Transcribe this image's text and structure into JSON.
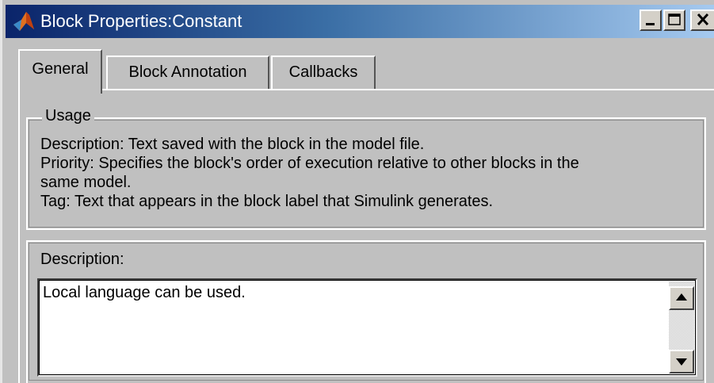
{
  "window": {
    "title": "Block Properties:Constant",
    "icon": "matlab-icon"
  },
  "title_buttons": {
    "minimize_icon": "minimize-icon",
    "maximize_icon": "maximize-icon",
    "close_icon": "close-icon"
  },
  "tabs": [
    {
      "label": "General",
      "selected": true
    },
    {
      "label": "Block Annotation",
      "selected": false
    },
    {
      "label": "Callbacks",
      "selected": false
    }
  ],
  "usage": {
    "legend": "Usage",
    "lines": [
      "Description: Text saved with the block in the model file.",
      "Priority: Specifies the block's order of execution relative to other blocks in the",
      "same model.",
      "Tag: Text that appears in the block label that Simulink generates."
    ]
  },
  "description": {
    "label": "Description:",
    "value": "Local language can be used."
  },
  "colors": {
    "title_bar_start": "#0a246a",
    "title_bar_end": "#a6caf0",
    "face": "#c0c0c0"
  }
}
